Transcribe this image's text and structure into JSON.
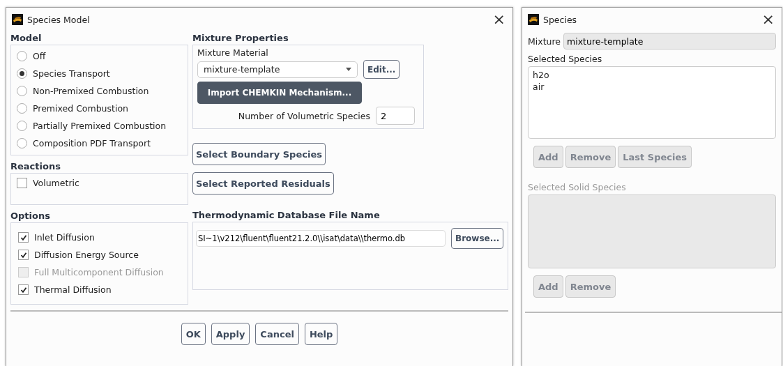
{
  "species_model_dialog": {
    "title": "Species Model",
    "close": "×",
    "model": {
      "heading": "Model",
      "options": [
        {
          "label": "Off",
          "selected": false
        },
        {
          "label": "Species Transport",
          "selected": true
        },
        {
          "label": "Non-Premixed Combustion",
          "selected": false
        },
        {
          "label": "Premixed Combustion",
          "selected": false
        },
        {
          "label": "Partially Premixed Combustion",
          "selected": false
        },
        {
          "label": "Composition PDF Transport",
          "selected": false
        }
      ]
    },
    "reactions": {
      "heading": "Reactions",
      "options": [
        {
          "label": "Volumetric",
          "checked": false,
          "disabled": false
        }
      ]
    },
    "options": {
      "heading": "Options",
      "options": [
        {
          "label": "Inlet Diffusion",
          "checked": true,
          "disabled": false
        },
        {
          "label": "Diffusion Energy Source",
          "checked": true,
          "disabled": false
        },
        {
          "label": "Full Multicomponent Diffusion",
          "checked": false,
          "disabled": true
        },
        {
          "label": "Thermal Diffusion",
          "checked": true,
          "disabled": false
        }
      ]
    },
    "mixture_properties": {
      "heading": "Mixture Properties",
      "material_label": "Mixture Material",
      "material_value": "mixture-template",
      "edit_button": "Edit...",
      "import_button": "Import CHEMKIN Mechanism...",
      "species_count_label": "Number of Volumetric Species",
      "species_count": "2"
    },
    "side_buttons": [
      "Select Boundary Species",
      "Select Reported Residuals"
    ],
    "thermo": {
      "heading": "Thermodynamic Database File Name",
      "value": "SI~1\\v212\\fluent\\fluent21.2.0\\\\isat\\data\\\\thermo.db",
      "browse_button": "Browse..."
    },
    "buttons": [
      "OK",
      "Apply",
      "Cancel",
      "Help"
    ]
  },
  "species_dialog": {
    "title": "Species",
    "close": "×",
    "mixture_label": "Mixture",
    "mixture_value": "mixture-template",
    "selected_species": {
      "label": "Selected Species",
      "disabled": false,
      "items": [
        "h2o",
        "air"
      ],
      "buttons": [
        {
          "label": "Add",
          "disabled": true
        },
        {
          "label": "Remove",
          "disabled": true
        },
        {
          "label": "Last Species",
          "disabled": true
        }
      ]
    },
    "selected_solid_species": {
      "label": "Selected Solid Species",
      "disabled": true,
      "buttons": [
        {
          "label": "Add",
          "disabled": true
        },
        {
          "label": "Remove",
          "disabled": true
        }
      ]
    }
  }
}
